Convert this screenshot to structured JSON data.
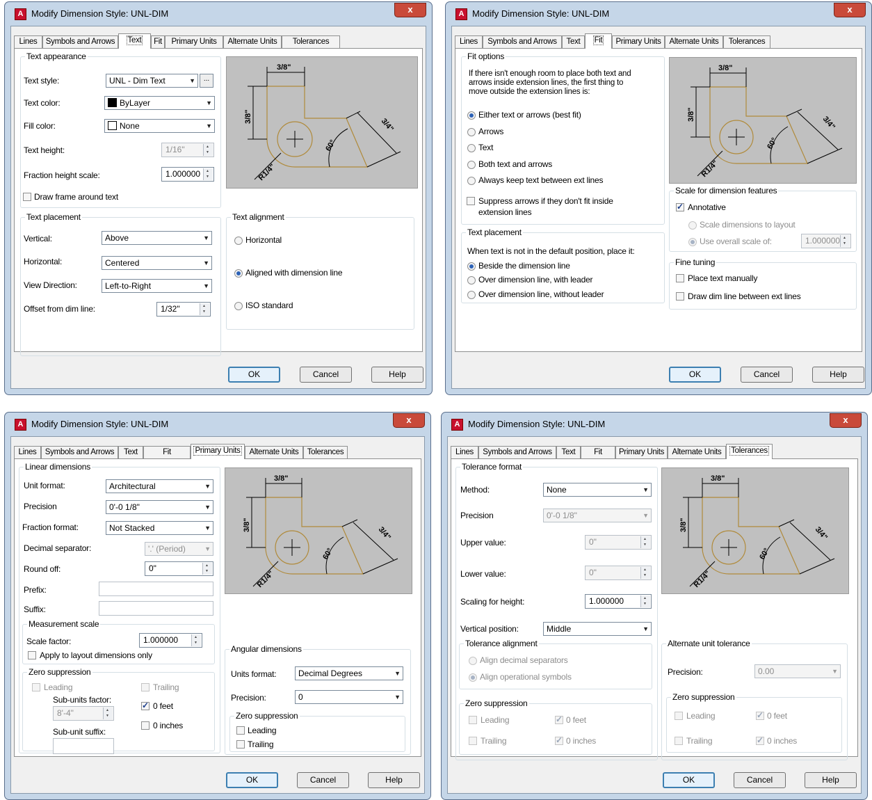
{
  "app": {
    "title": "Modify Dimension Style: UNL-DIM",
    "close": "x",
    "app_icon": "A"
  },
  "tabs": [
    "Lines",
    "Symbols and Arrows",
    "Text",
    "Fit",
    "Primary Units",
    "Alternate Units",
    "Tolerances"
  ],
  "buttons": {
    "ok": "OK",
    "cancel": "Cancel",
    "help": "Help"
  },
  "preview": {
    "dim_top": "3/8\"",
    "dim_left": "3/8\"",
    "dim_right": "3/4\"",
    "angle": "60°",
    "radius": "R1/4\""
  },
  "colors": {
    "drawing_stroke": "#b08a3a",
    "preview_bg": "#c0c0c0",
    "dialog_frame": "#c5d6e8"
  },
  "text_tab": {
    "appearance_title": "Text appearance",
    "text_style_label": "Text style:",
    "text_style_value": "UNL - Dim Text",
    "ellipsis": "...",
    "text_color_label": "Text color:",
    "text_color_value": "ByLayer",
    "fill_color_label": "Fill color:",
    "fill_color_value": "None",
    "text_height_label": "Text height:",
    "text_height_value": "1/16\"",
    "fraction_label": "Fraction height scale:",
    "fraction_value": "1.000000",
    "draw_frame_label": "Draw frame around text",
    "placement_title": "Text placement",
    "vertical_label": "Vertical:",
    "vertical_value": "Above",
    "horizontal_label": "Horizontal:",
    "horizontal_value": "Centered",
    "view_label": "View Direction:",
    "view_value": "Left-to-Right",
    "offset_label": "Offset from dim line:",
    "offset_value": "1/32\"",
    "alignment_title": "Text alignment",
    "align_horizontal": "Horizontal",
    "align_dimline": "Aligned with dimension line",
    "align_iso": "ISO standard"
  },
  "fit_tab": {
    "options_title": "Fit options",
    "options_desc": "If there isn't enough room to place both text and arrows inside extension lines, the first thing to move outside the extension lines is:",
    "opt_either": "Either text or arrows (best fit)",
    "opt_arrows": "Arrows",
    "opt_text": "Text",
    "opt_both": "Both text and arrows",
    "opt_keep": "Always keep text between ext lines",
    "suppress_label": "Suppress arrows if they don't fit inside extension lines",
    "placement_title": "Text placement",
    "placement_desc": "When text is not in the default position, place it:",
    "place_beside": "Beside the dimension line",
    "place_over_leader": "Over dimension line, with leader",
    "place_over_noleader": "Over dimension line, without leader",
    "scale_title": "Scale for dimension features",
    "annotative_label": "Annotative",
    "scale_layout": "Scale dimensions to layout",
    "overall_label": "Use overall scale of:",
    "overall_value": "1.000000",
    "tuning_title": "Fine tuning",
    "place_manual": "Place text manually",
    "draw_dim": "Draw dim line between ext lines"
  },
  "primary_tab": {
    "linear_title": "Linear dimensions",
    "unit_format_label": "Unit format:",
    "unit_format_value": "Architectural",
    "precision_label": "Precision",
    "precision_value": "0'-0 1/8\"",
    "fraction_label": "Fraction format:",
    "fraction_value": "Not Stacked",
    "decimal_label": "Decimal separator:",
    "decimal_value": "'.' (Period)",
    "roundoff_label": "Round off:",
    "roundoff_value": "0\"",
    "prefix_label": "Prefix:",
    "suffix_label": "Suffix:",
    "measure_title": "Measurement scale",
    "scale_label": "Scale factor:",
    "scale_value": "1.000000",
    "apply_layout": "Apply to layout dimensions only",
    "zero_title": "Zero suppression",
    "leading": "Leading",
    "trailing": "Trailing",
    "subunits_label": "Sub-units factor:",
    "subunits_value": "8'-4\"",
    "subunit_suffix": "Sub-unit suffix:",
    "zero_feet": "0 feet",
    "zero_inches": "0 inches",
    "angular_title": "Angular dimensions",
    "ang_units_label": "Units format:",
    "ang_units_value": "Decimal Degrees",
    "ang_precision_label": "Precision:",
    "ang_precision_value": "0",
    "ang_zero_title": "Zero suppression",
    "ang_leading": "Leading",
    "ang_trailing": "Trailing"
  },
  "tol_tab": {
    "format_title": "Tolerance format",
    "method_label": "Method:",
    "method_value": "None",
    "precision_label": "Precision",
    "precision_value": "0'-0 1/8\"",
    "upper_label": "Upper value:",
    "upper_value": "0\"",
    "lower_label": "Lower value:",
    "lower_value": "0\"",
    "scaling_label": "Scaling for height:",
    "scaling_value": "1.000000",
    "vertical_label": "Vertical position:",
    "vertical_value": "Middle",
    "align_title": "Tolerance alignment",
    "align_decimal": "Align decimal separators",
    "align_operational": "Align operational symbols",
    "zero_title": "Zero suppression",
    "leading": "Leading",
    "trailing": "Trailing",
    "zero_feet": "0 feet",
    "zero_inches": "0 inches",
    "alt_title": "Alternate unit tolerance",
    "alt_precision_label": "Precision:",
    "alt_precision_value": "0.00",
    "alt_zero_title": "Zero suppression",
    "alt_leading": "Leading",
    "alt_trailing": "Trailing",
    "alt_feet": "0 feet",
    "alt_inches": "0 inches"
  }
}
